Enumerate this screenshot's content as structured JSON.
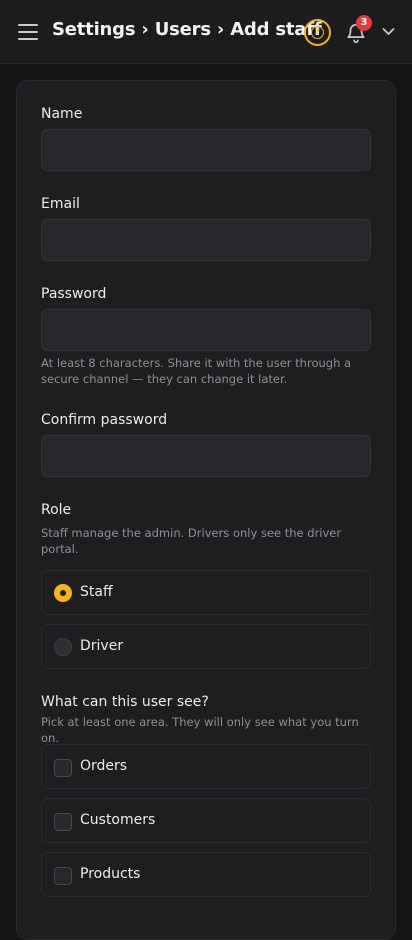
{
  "header": {
    "title": "Settings › Users › Add staff",
    "notification_count": "3"
  },
  "form": {
    "name": {
      "label": "Name",
      "value": ""
    },
    "email": {
      "label": "Email",
      "value": ""
    },
    "password": {
      "label": "Password",
      "value": "",
      "hint": "At least 8 characters. Share it with the user through a secure channel — they can change it later."
    },
    "confirm_password": {
      "label": "Confirm password",
      "value": ""
    },
    "role": {
      "label": "Role",
      "hint": "Staff manage the admin. Drivers only see the driver portal.",
      "options": [
        {
          "label": "Staff",
          "selected": true
        },
        {
          "label": "Driver",
          "selected": false
        }
      ]
    },
    "areas": {
      "label": "What can this user see?",
      "hint": "Pick at least one area. They will only see what you turn on.",
      "options": [
        {
          "label": "Orders",
          "checked": false
        },
        {
          "label": "Customers",
          "checked": false
        },
        {
          "label": "Products",
          "checked": false
        }
      ]
    }
  },
  "colors": {
    "accent": "#f5b31f",
    "badge": "#e5383b",
    "background": "#141416",
    "card": "#1e1e21"
  },
  "icons": [
    "menu-icon",
    "help-icon",
    "bell-icon",
    "chevron-down-icon"
  ]
}
